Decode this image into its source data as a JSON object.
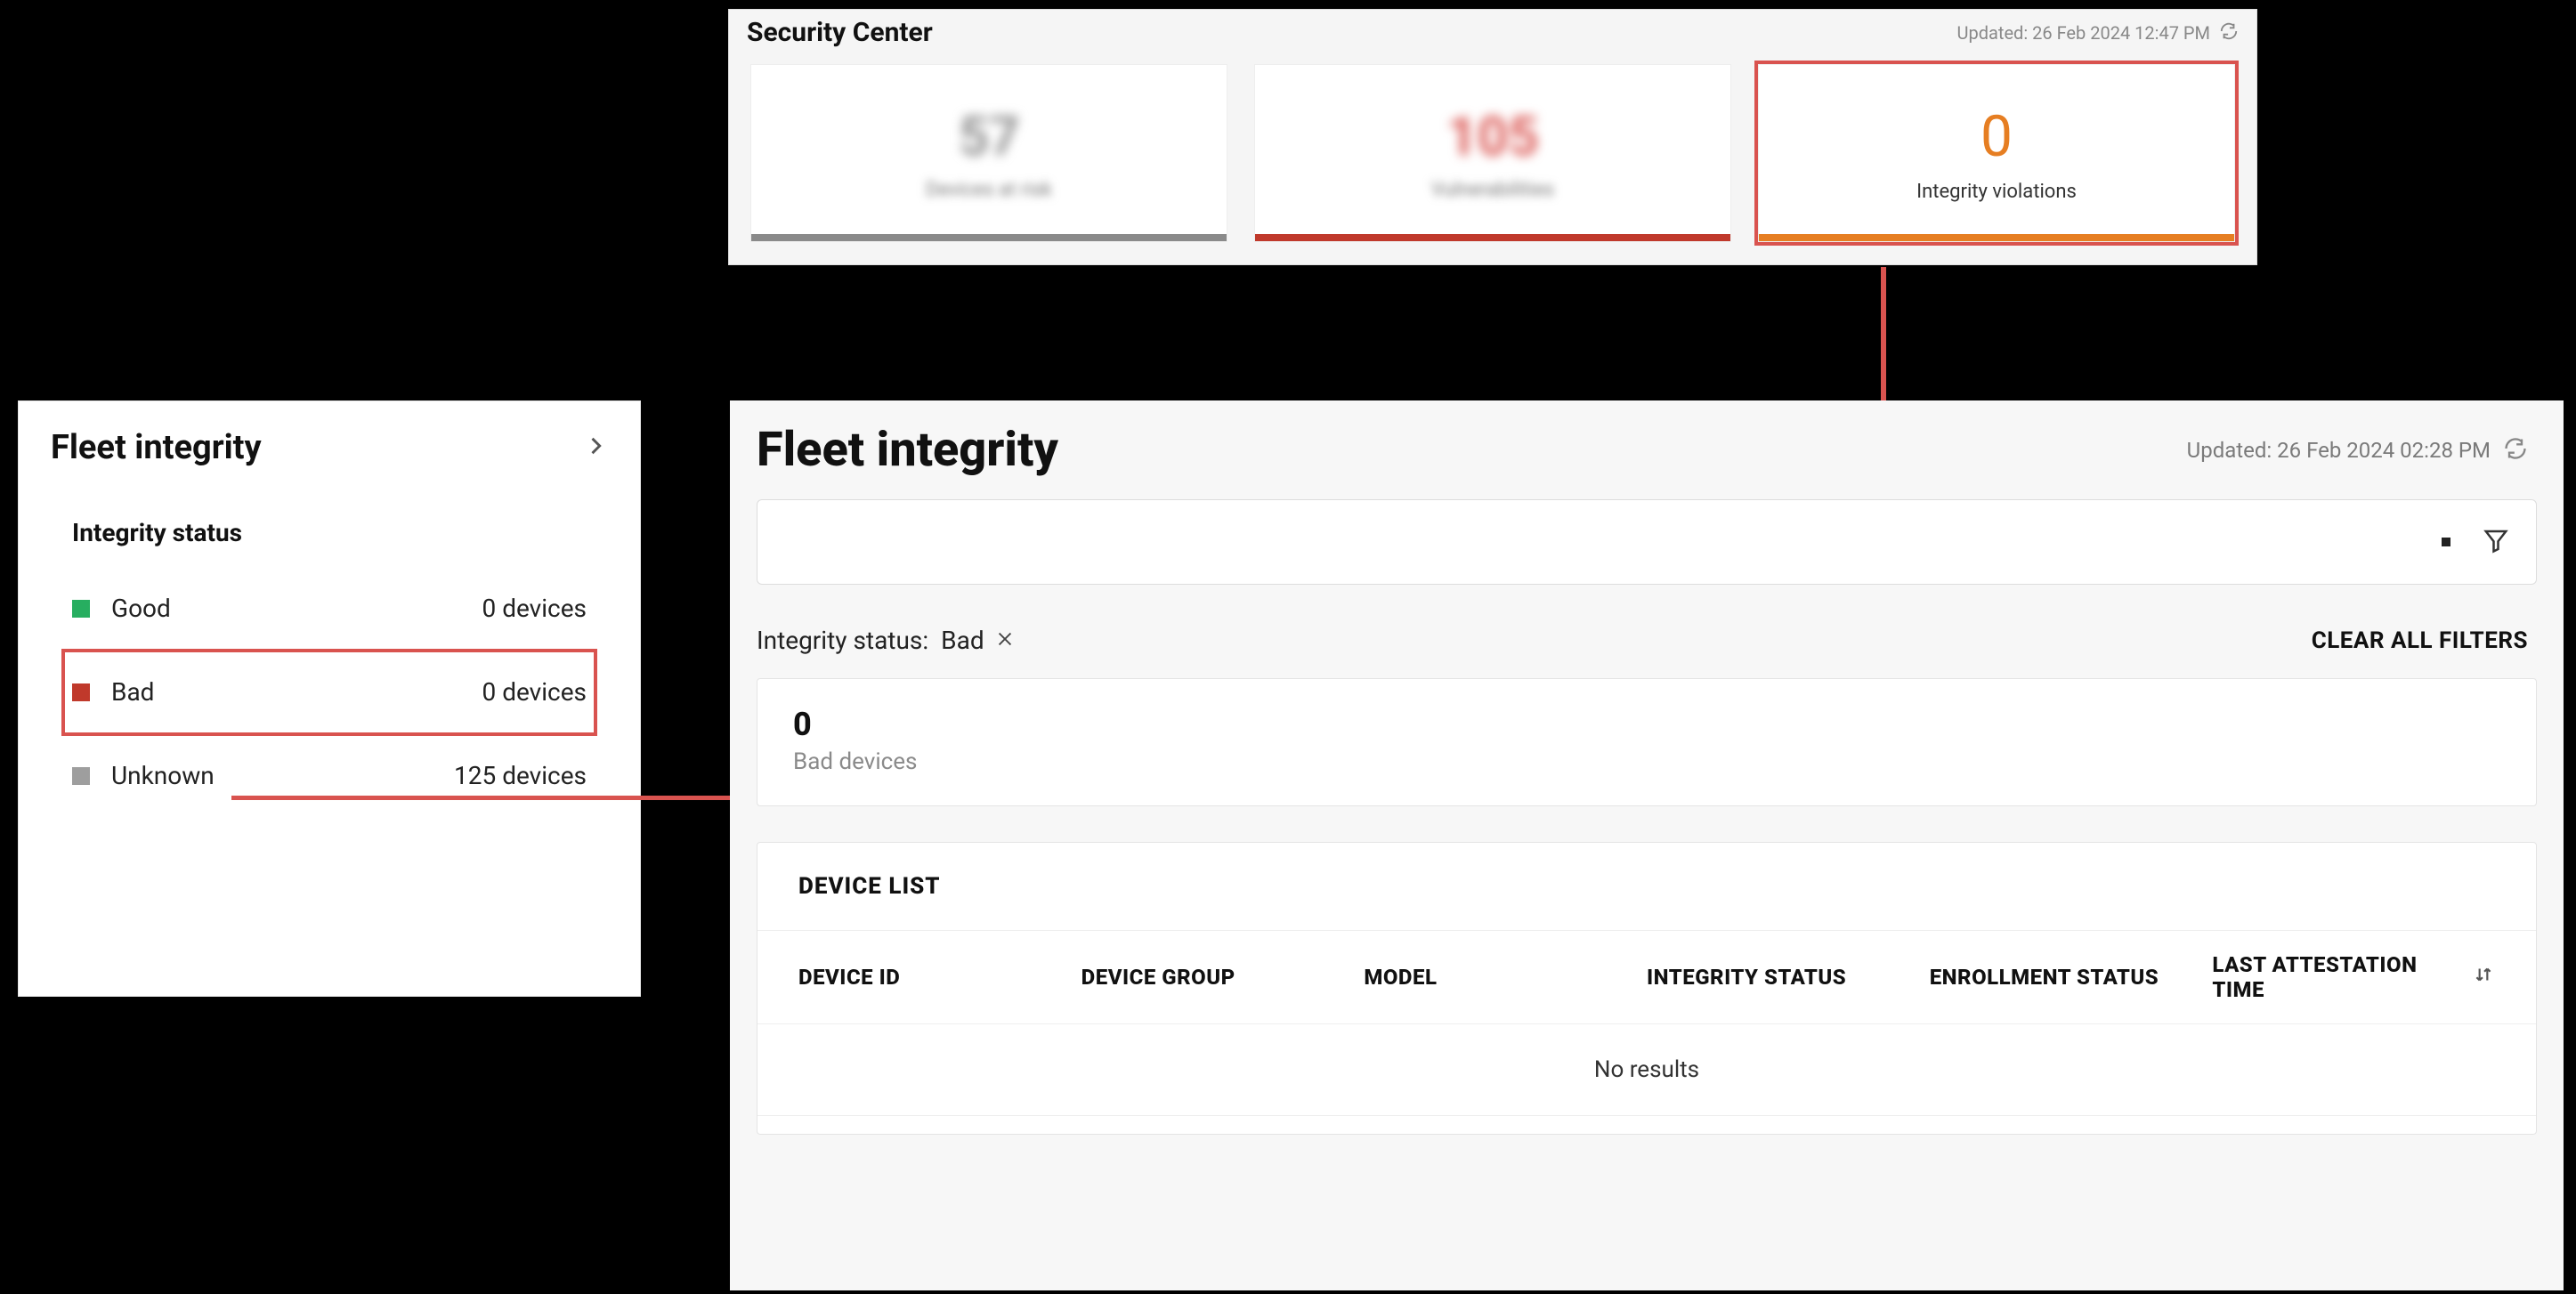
{
  "security_center": {
    "title": "Security Center",
    "updated": "Updated: 26 Feb 2024 12:47 PM",
    "tiles": [
      {
        "value": "57",
        "label": "Devices at risk"
      },
      {
        "value": "105",
        "label": "Vulnerabilities"
      },
      {
        "value": "0",
        "label": "Integrity violations"
      }
    ]
  },
  "sidebar": {
    "title": "Fleet integrity",
    "subtitle": "Integrity status",
    "rows": [
      {
        "name": "Good",
        "count": "0 devices"
      },
      {
        "name": "Bad",
        "count": "0 devices"
      },
      {
        "name": "Unknown",
        "count": "125 devices"
      }
    ]
  },
  "main": {
    "title": "Fleet integrity",
    "updated": "Updated: 26 Feb 2024 02:28 PM",
    "filter_label": "Integrity status:",
    "filter_value": "Bad",
    "clear_filters": "CLEAR ALL FILTERS",
    "count": "0",
    "count_label": "Bad devices",
    "table_title": "DEVICE LIST",
    "columns": [
      "DEVICE ID",
      "DEVICE GROUP",
      "MODEL",
      "INTEGRITY STATUS",
      "ENROLLMENT STATUS",
      "LAST ATTESTATION TIME"
    ],
    "no_results": "No results"
  }
}
